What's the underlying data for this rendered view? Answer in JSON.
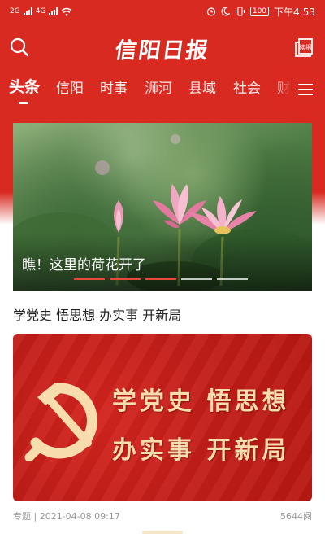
{
  "status_bar": {
    "signal1": "2G",
    "signal2": "4G",
    "battery": "100",
    "time": "下午4:53",
    "icons": [
      "alarm-icon",
      "moon-icon",
      "vibrate-icon",
      "battery-icon",
      "wifi-icon"
    ]
  },
  "header": {
    "logo": "信阳日报",
    "epaper_label": "读报"
  },
  "tabs": [
    "头条",
    "信阳",
    "时事",
    "浉河",
    "县域",
    "社会",
    "财"
  ],
  "active_tab": "头条",
  "banner": {
    "caption": "瞧！这里的荷花开了",
    "slide_count": 5,
    "active_slides": [
      1,
      2,
      3
    ]
  },
  "article": {
    "title": "学党史 悟思想 办实事 开新局",
    "thumbnail_slogan_line1": "学党史  悟思想",
    "thumbnail_slogan_line2": "办实事  开新局",
    "category": "专题",
    "date": "2021-04-08 09:17",
    "views": "5644阅"
  },
  "colors": {
    "brand_red": "#d92a22",
    "slogan_gold": "#f7dcae"
  }
}
